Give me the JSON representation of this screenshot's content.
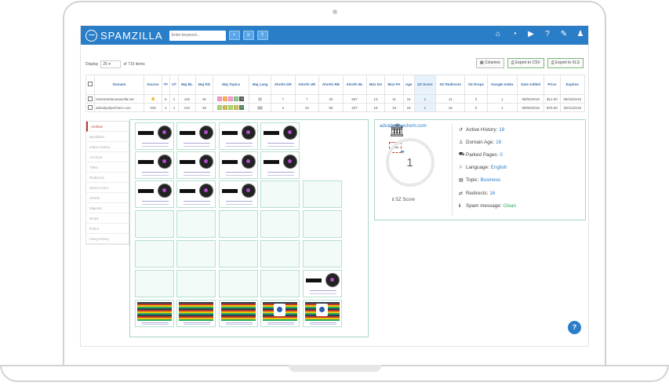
{
  "app": {
    "logo_text": "SPAMZILLA",
    "search_placeholder": "Enter keyword...",
    "btn_add": "+",
    "btn_list": "≡",
    "btn_filter": "Y"
  },
  "toolbar": {
    "display_label": "Display",
    "per_page": "25",
    "total_text": "of 715 items",
    "columns_label": "Columns",
    "export_csv": "Export to CSV",
    "export_xls": "Export to XLS"
  },
  "table": {
    "headers": [
      "",
      "Domain",
      "Source",
      "TF",
      "CF",
      "Maj BL",
      "Maj RD",
      "Maj Topics",
      "Maj Lang",
      "Ahrefs DR",
      "Ahrefs UR",
      "Ahrefs RB",
      "Ahrefs BL",
      "Moz DA",
      "Moz PA",
      "Age",
      "SZ Score",
      "SZ Redirects",
      "SZ Drops",
      "Google Index",
      "Date Added",
      "Price",
      "Expires"
    ],
    "rows": [
      {
        "domain": "ristorantelacanavella.net",
        "source": "👍",
        "tf": "6",
        "cf": "1",
        "maj_bl": "119",
        "maj_rd": "36",
        "topics": [
          "1",
          "1",
          "4",
          "4",
          "4"
        ],
        "topic_colors": [
          "#e88fc7",
          "#f0a84a",
          "#e88fc7",
          "#7cc07c",
          "#555555"
        ],
        "lang": "IT",
        "dr": "7",
        "ur": "7",
        "rb": "33",
        "bl": "667",
        "da": "13",
        "pa": "11",
        "age": "15",
        "sz": "1",
        "redirects": "11",
        "drops": "3",
        "gindex": "1",
        "date": "08/06/2018",
        "price": "$12.00",
        "expires": "08/15/2018"
      },
      {
        "domain": "advaityadyechem.com",
        "source": "GM",
        "tf": "4",
        "cf": "1",
        "maj_bl": "122",
        "maj_rd": "48",
        "topics": [
          "4",
          "1",
          "2",
          "2",
          "2"
        ],
        "topic_colors": [
          "#9ccc65",
          "#c7b24a",
          "#9ccc65",
          "#c7b24a",
          "#4a7c59"
        ],
        "lang": "EN",
        "dr": "3",
        "ur": "10",
        "rb": "55",
        "bl": "207",
        "da": "18",
        "pa": "19",
        "age": "18",
        "sz": "1",
        "redirects": "16",
        "drops": "0",
        "gindex": "1",
        "date": "08/06/2018",
        "price": "$79.00",
        "expires": "08/11/2018"
      }
    ]
  },
  "side_tabs": [
    "Archive",
    "Backlinks",
    "Index History",
    "Anchors",
    "Titles",
    "Redirects",
    "Word Count",
    "Ahrefs",
    "Majestic",
    "Drops",
    "Robot",
    "Lang History"
  ],
  "score_panel": {
    "domain": "advaityadyechem.com",
    "score": "1",
    "score_label": "SZ Score",
    "stats": [
      {
        "icon": "history-icon",
        "glyph": "↺",
        "label": "Active History:",
        "value": "18"
      },
      {
        "icon": "age-icon",
        "glyph": "♙",
        "label": "Domain Age:",
        "value": "18"
      },
      {
        "icon": "car-icon",
        "glyph": "⛟",
        "label": "Parked Pages:",
        "value": "0"
      },
      {
        "icon": "language-icon",
        "glyph": "⚐",
        "label": "Language:",
        "value": "English"
      },
      {
        "icon": "topic-icon",
        "glyph": "▤",
        "label": "Topic:",
        "value": "Business"
      },
      {
        "icon": "redirect-icon",
        "glyph": "⇄",
        "label": "Redirects:",
        "value": "16"
      },
      {
        "icon": "info-icon",
        "glyph": "ℹ",
        "label": "Spam message:",
        "value": "Clean"
      }
    ]
  },
  "colors": {
    "brand": "#2a7ec8",
    "archive_border": "#a9d6c2",
    "clean": "#27ae60"
  },
  "help_label": "?"
}
